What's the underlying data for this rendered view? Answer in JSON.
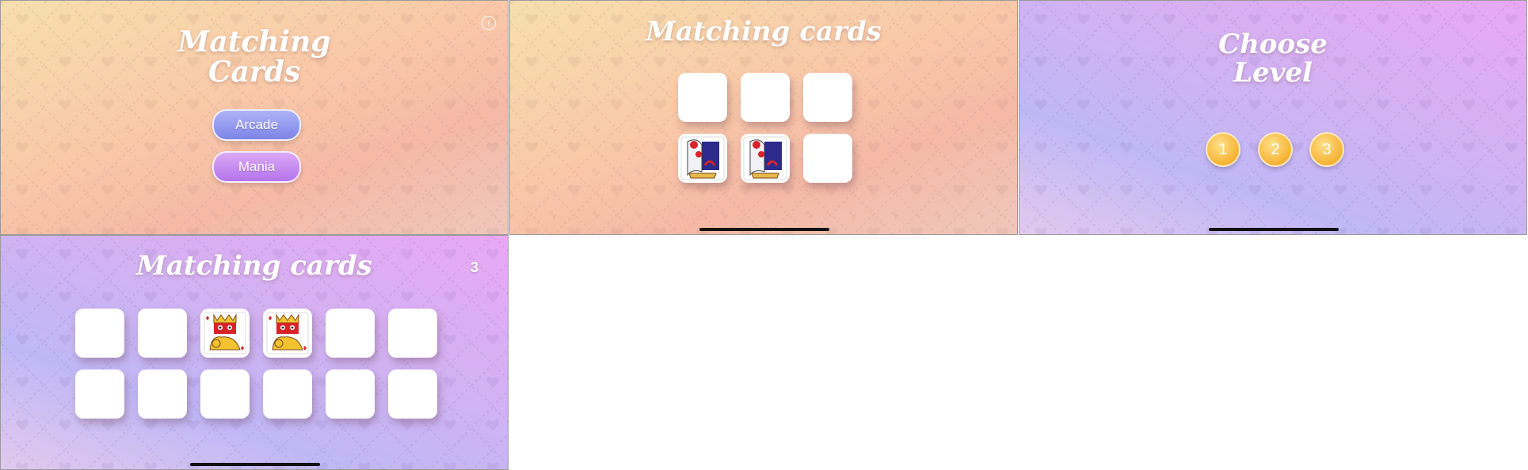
{
  "colors": {
    "arcade_button": "#8f95ee",
    "mania_button": "#c98af0",
    "level_button": "#f6b232",
    "card_back": "#ffffff"
  },
  "menu": {
    "title_line1": "Matching",
    "title_line2": "Cards",
    "arcade_label": "Arcade",
    "mania_label": "Mania",
    "info_icon": "info-icon"
  },
  "game_small": {
    "title": "Matching cards",
    "cards": [
      "hidden",
      "hidden",
      "hidden",
      "joker",
      "joker",
      "hidden"
    ]
  },
  "levels": {
    "title_line1": "Choose",
    "title_line2": "Level",
    "options": [
      "1",
      "2",
      "3"
    ]
  },
  "game_large": {
    "title": "Matching cards",
    "score": "3",
    "cards": [
      "hidden",
      "hidden",
      "king",
      "king",
      "hidden",
      "hidden",
      "hidden",
      "hidden",
      "hidden",
      "hidden",
      "hidden",
      "hidden"
    ]
  }
}
